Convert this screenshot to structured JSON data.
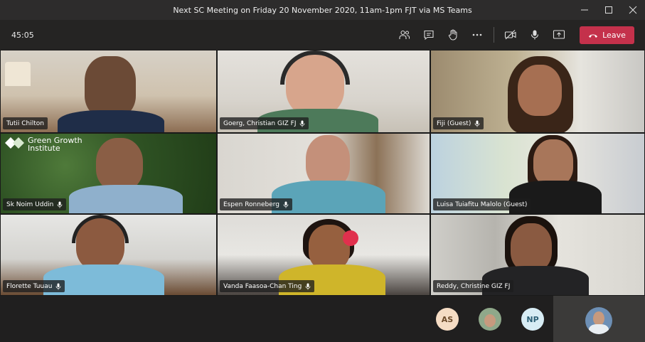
{
  "window": {
    "title": "Next SC Meeting on Friday 20 November 2020, 11am-1pm FJT via MS Teams",
    "minimize_icon": "minimize-icon",
    "maximize_icon": "maximize-icon",
    "close_icon": "close-icon"
  },
  "toolbar": {
    "timer": "45:05",
    "icons": [
      "participants-icon",
      "chat-icon",
      "raise-hand-icon",
      "more-icon",
      "camera-off-icon",
      "microphone-icon",
      "share-screen-icon"
    ],
    "leave_label": "Leave",
    "leave_color": "#c4314b"
  },
  "participants": [
    {
      "name": "Tutii Chilton",
      "mic": false
    },
    {
      "name": "Goerg, Christian GIZ FJ",
      "mic": true
    },
    {
      "name": "Fiji (Guest)",
      "mic": true
    },
    {
      "name": "Sk Noim Uddin",
      "mic": true
    },
    {
      "name": "Espen Ronneberg",
      "mic": true
    },
    {
      "name": "Luisa Tuiafitu Malolo (Guest)",
      "mic": false
    },
    {
      "name": "Florette Tuuau",
      "mic": true
    },
    {
      "name": "Vanda Faasoa-Chan Ting",
      "mic": true
    },
    {
      "name": "Reddy, Christine GIZ FJ",
      "mic": false
    }
  ],
  "logo_text": {
    "line1": "Green Growth",
    "line2": "Institute"
  },
  "overflow": {
    "avatar1_initials": "AS",
    "avatar3_initials": "NP"
  }
}
